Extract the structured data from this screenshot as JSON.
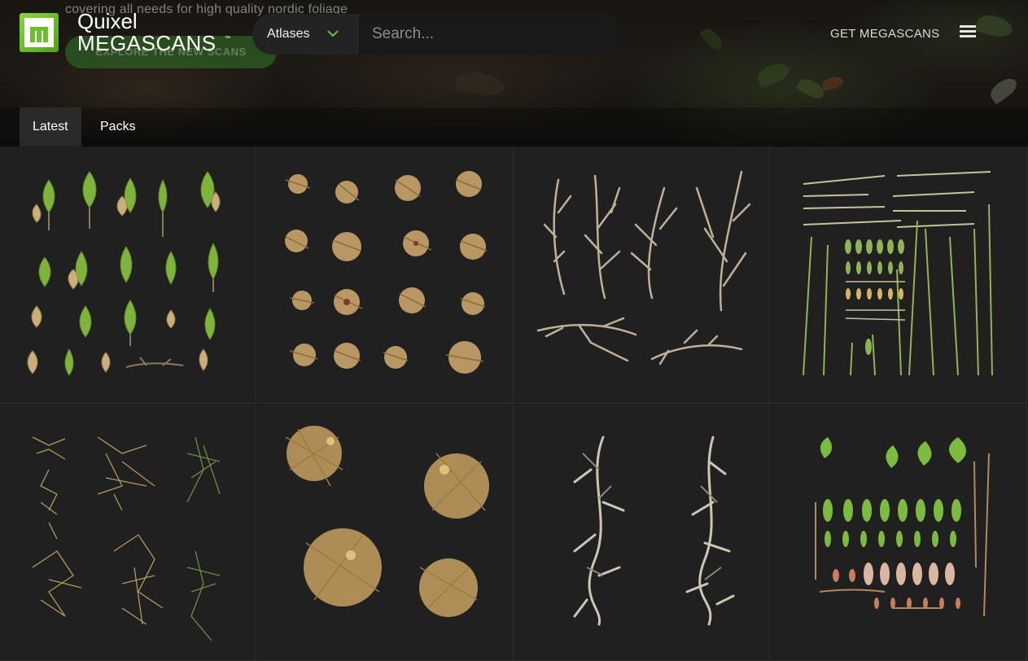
{
  "hero": {
    "tagline": "covering all needs for high quality nordic foliage",
    "cta_label": "EXPLORE THE NEW SCANS"
  },
  "brand": {
    "name_top": "Quixel",
    "name_bottom": "MEGASCANS",
    "trademark": "™",
    "logo_letter": "m",
    "accent": "#6cc02d"
  },
  "search": {
    "category": "Atlases",
    "placeholder": "Search..."
  },
  "nav": {
    "get_link": "GET MEGASCANS",
    "menu_icon": "hamburger-menu-icon"
  },
  "tabs": [
    {
      "label": "Latest",
      "active": true
    },
    {
      "label": "Packs",
      "active": false
    }
  ],
  "grid": {
    "items": [
      {
        "subject": "green sprouts with dry leaves",
        "palette": [
          "#7fb43c",
          "#c9b07a"
        ]
      },
      {
        "subject": "dried autumn foliage clumps",
        "palette": [
          "#c9a46a",
          "#8e6a3c"
        ]
      },
      {
        "subject": "bare branches",
        "palette": [
          "#bfb096",
          "#8c7c64"
        ]
      },
      {
        "subject": "grass stems and leaf strips",
        "palette": [
          "#8fb455",
          "#c7c29a"
        ]
      },
      {
        "subject": "dry grass tufts",
        "palette": [
          "#b49a5c",
          "#6f8f3d"
        ]
      },
      {
        "subject": "dry leaf litter clusters",
        "palette": [
          "#c7a060",
          "#9b7a45"
        ]
      },
      {
        "subject": "gnarled twig clusters",
        "palette": [
          "#cfc6b2",
          "#8f8572"
        ]
      },
      {
        "subject": "leaf and petal atlas",
        "palette": [
          "#7bbb3d",
          "#d9b7a0"
        ]
      }
    ]
  }
}
